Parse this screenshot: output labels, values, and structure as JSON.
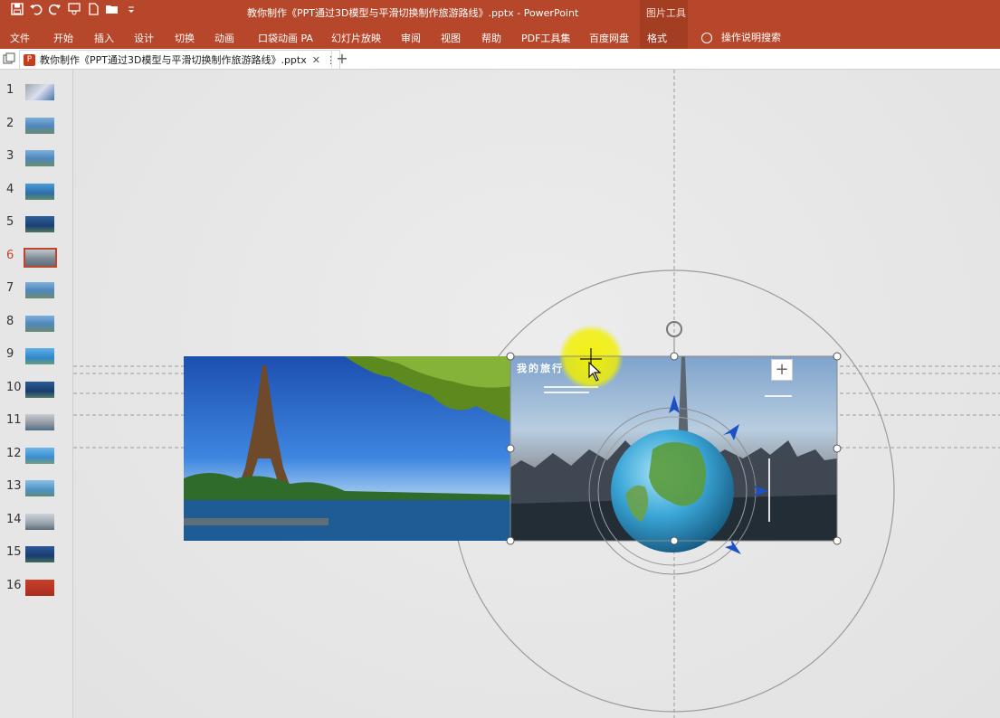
{
  "window": {
    "doc_title": "教你制作《PPT通过3D模型与平滑切换制作旅游路线》.pptx  -  PowerPoint",
    "context_group": "图片工具"
  },
  "qat": {
    "save_icon": "save-icon",
    "undo_icon": "undo-icon",
    "redo_icon": "redo-icon",
    "presenter_icon": "from-beginning-icon",
    "new_icon": "new-file-icon",
    "open_icon": "open-folder-icon",
    "customize_icon": "customize-qat-icon"
  },
  "ribbon": {
    "tabs": [
      "文件",
      "开始",
      "插入",
      "设计",
      "切换",
      "动画",
      "口袋动画 PA",
      "幻灯片放映",
      "审阅",
      "视图",
      "帮助",
      "PDF工具集",
      "百度网盘",
      "格式"
    ],
    "active_tab": "格式",
    "search_text": "操作说明搜索"
  },
  "doc_tab": {
    "label": "教你制作《PPT通过3D模型与平滑切换制作旅游路线》.pptx",
    "close": "✕",
    "more": "⋮",
    "new": "+"
  },
  "thumbnails": {
    "numbers": [
      "1",
      "2",
      "3",
      "4",
      "5",
      "6",
      "7",
      "8",
      "9",
      "10",
      "11",
      "12",
      "13",
      "14",
      "15",
      "16"
    ],
    "selected": 6
  },
  "slide": {
    "add_button": "+",
    "picture_right_title": "我的旅行"
  },
  "colors": {
    "ribbon_bg": "#b7472a",
    "ribbon_active": "#a33e23",
    "selection_accent": "#c0452a",
    "canvas_bg": "#e6e6e6",
    "highlight_cursor": "#f2f000"
  }
}
